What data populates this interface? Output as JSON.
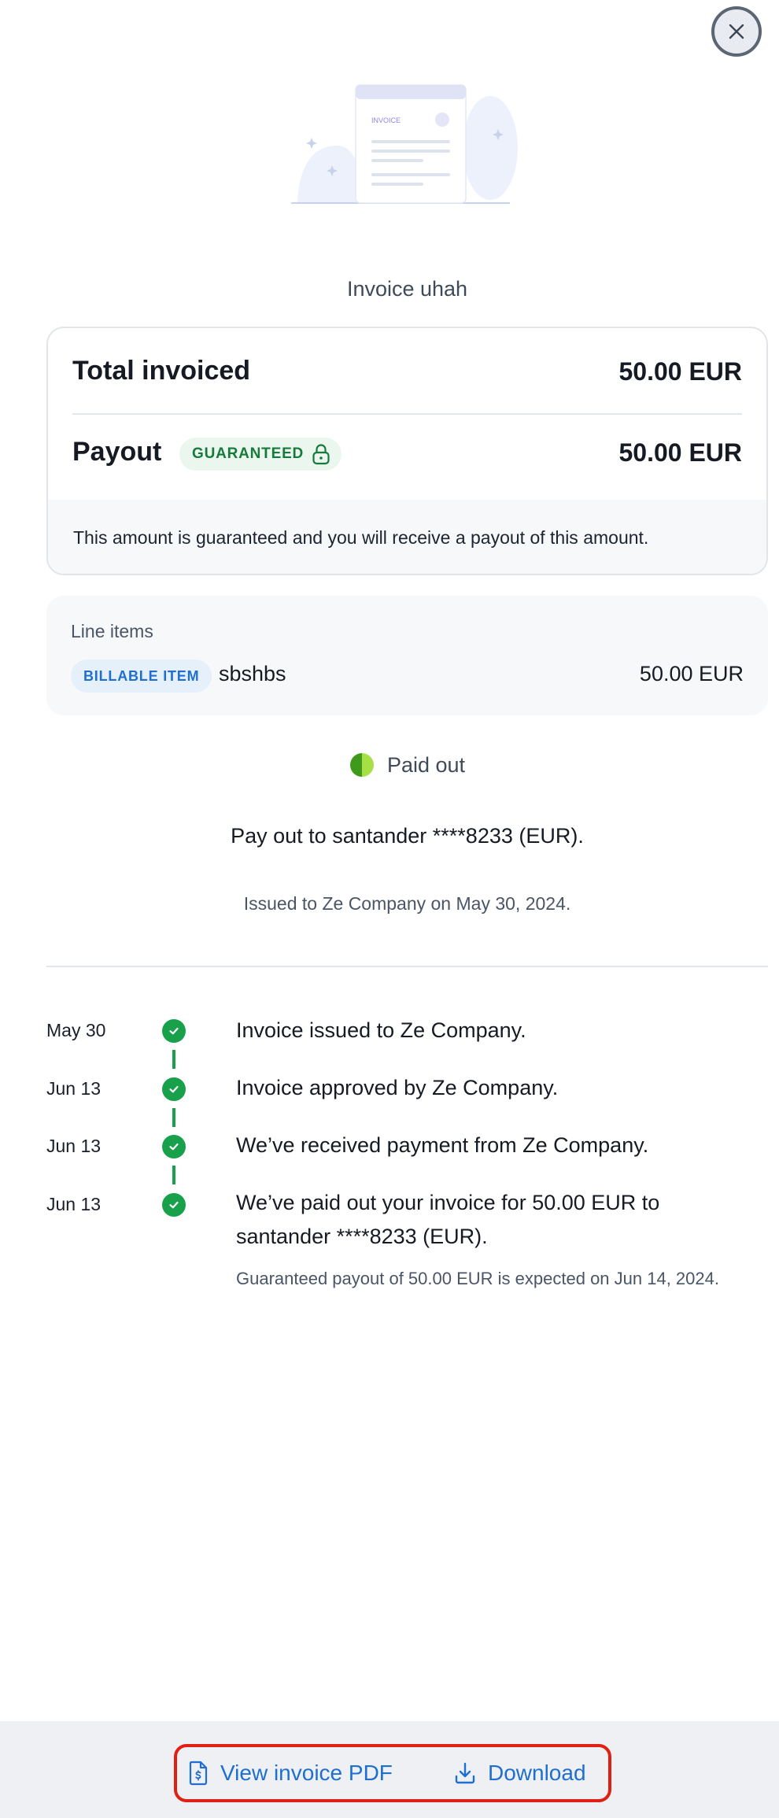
{
  "close": {
    "icon": "close-icon"
  },
  "illustration": {
    "label": "INVOICE"
  },
  "invoice": {
    "title": "Invoice uhah"
  },
  "summary": {
    "total_label": "Total invoiced",
    "total_value": "50.00 EUR",
    "payout_label": "Payout",
    "payout_badge": "GUARANTEED",
    "payout_value": "50.00 EUR",
    "note": "This amount is guaranteed and you will receive a payout of this amount."
  },
  "line_items": {
    "heading": "Line items",
    "items": [
      {
        "badge": "BILLABLE ITEM",
        "name": "sbshbs",
        "amount": "50.00 EUR"
      }
    ]
  },
  "status": {
    "label": "Paid out",
    "destination": "Pay out to santander ****8233 (EUR).",
    "issued": "Issued to Ze Company on May 30, 2024."
  },
  "timeline": [
    {
      "date": "May 30",
      "text": "Invoice issued to Ze Company."
    },
    {
      "date": "Jun 13",
      "text": "Invoice approved by Ze Company."
    },
    {
      "date": "Jun 13",
      "text": "We’ve received payment from Ze Company."
    },
    {
      "date": "Jun 13",
      "text": "We’ve paid out your invoice for 50.00 EUR to santander ****8233 (EUR).",
      "sub": "Guaranteed payout of 50.00 EUR is expected on Jun 14, 2024."
    }
  ],
  "actions": {
    "view_pdf": "View invoice PDF",
    "download": "Download"
  },
  "colors": {
    "accent": "#1f6fd0",
    "success": "#18a04a",
    "highlight": "#e11f12"
  }
}
